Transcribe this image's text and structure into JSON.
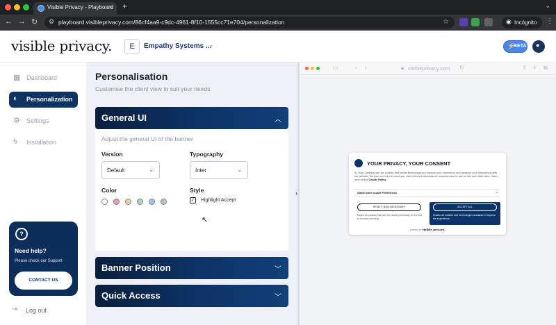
{
  "browser": {
    "tab_title": "Visible Privacy - Playboard",
    "tab_close": "×",
    "new_tab": "+",
    "tab_menu": "⌄",
    "back": "←",
    "forward": "→",
    "reload": "↻",
    "url": "playboard.visibleprivacy.com/86cf4aa9-c9dc-4961-8f10-1555cc71e704/personalization",
    "incognito_label": "Incógnito"
  },
  "header": {
    "logo": "visible privacy.",
    "workspace_initial": "E",
    "workspace_name": "Empathy Systems ...",
    "beta_label": "BETA"
  },
  "sidebar": {
    "items": [
      {
        "label": "Dashboard",
        "icon": "grid-icon"
      },
      {
        "label": "Personalization",
        "icon": "palette-icon"
      },
      {
        "label": "Settings",
        "icon": "gear-icon"
      },
      {
        "label": "Installation",
        "icon": "lightning-icon"
      }
    ],
    "active_index": 1,
    "help": {
      "badge": "?",
      "title": "Need help?",
      "subtitle": "Please check our Support",
      "button": "CONTACT US"
    },
    "logout": "Log out"
  },
  "main": {
    "title": "Personalisation",
    "subtitle": "Customise the client view to suit your needs",
    "general_ui": {
      "title": "General UI",
      "subtitle": "Adjust the general UI of the banner",
      "version_label": "Version",
      "version_value": "Default",
      "typography_label": "Typography",
      "typography_value": "Inter",
      "color_label": "Color",
      "style_label": "Style",
      "highlight_accept_label": "Highlight Accept",
      "highlight_accept_checked": true,
      "color_swatches": [
        "#ffffff",
        "#e7a3ab",
        "#e8d59a",
        "#a8d6b6",
        "#9fc3ea",
        "rainbow"
      ]
    },
    "banner_position": {
      "title": "Banner Position"
    },
    "quick_access": {
      "title": "Quick Access"
    }
  },
  "preview": {
    "url": "visibleprivacy.com",
    "banner": {
      "title": "YOUR PRIVACY, YOUR CONSENT",
      "text": "At Your Company we use cookies and similar technologies to improve your experience and measure your interactions with our website. We also use them to send you more relevant information in searches and in ads on this and other sites. Learn more at our",
      "link": "Cookie Policy",
      "prefs_label": "Adjust your cookie Preferences",
      "reject_label": "REJECT NON-NECESSARY",
      "reject_desc": "Reject all cookies that are not strictly necessary for the site to function correctly.",
      "accept_label": "ACCEPT ALL",
      "accept_desc": "Enable all cookies and technologies available to improve the experience.",
      "powered_prefix": "powered by",
      "powered_brand": "visible privacy."
    }
  },
  "colors": {
    "brand_navy": "#0d3468",
    "accent_blue": "#4a87e8"
  }
}
